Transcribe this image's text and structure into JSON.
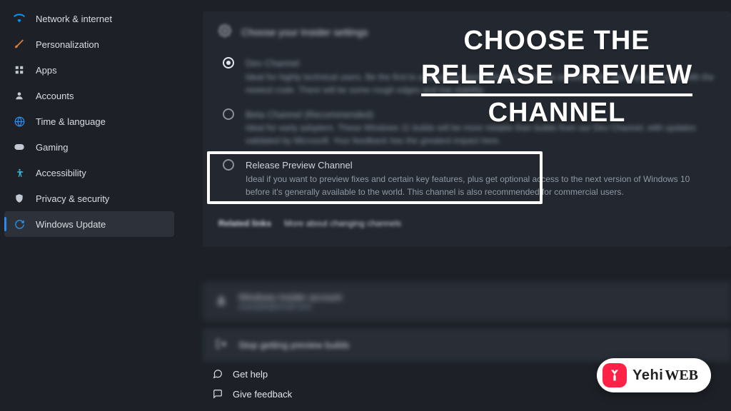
{
  "sidebar": {
    "items": [
      {
        "icon": "wifi-icon",
        "label": "Network & internet",
        "selected": false,
        "color": "#0099ff"
      },
      {
        "icon": "brush-icon",
        "label": "Personalization",
        "selected": false,
        "color": "#d67f3c"
      },
      {
        "icon": "grid-icon",
        "label": "Apps",
        "selected": false,
        "color": "#c1c8d1"
      },
      {
        "icon": "user-icon",
        "label": "Accounts",
        "selected": false,
        "color": "#c1c8d1"
      },
      {
        "icon": "globe-icon",
        "label": "Time & language",
        "selected": false,
        "color": "#2d8fe6"
      },
      {
        "icon": "gamepad-icon",
        "label": "Gaming",
        "selected": false,
        "color": "#c1c8d1"
      },
      {
        "icon": "access-icon",
        "label": "Accessibility",
        "selected": false,
        "color": "#44b5d6"
      },
      {
        "icon": "shield-icon",
        "label": "Privacy & security",
        "selected": false,
        "color": "#c1c8d1"
      },
      {
        "icon": "update-icon",
        "label": "Windows Update",
        "selected": true,
        "color": "#2d8fe6"
      }
    ]
  },
  "main": {
    "panel_title": "Choose your Insider settings",
    "options": [
      {
        "id": "dev",
        "title": "Dev Channel",
        "desc": "Ideal for highly technical users. Be the first to access the latest Windows 11 builds earliest in the development cycle with the newest code. There will be some rough edges and low stability.",
        "selected": true,
        "blurred": true
      },
      {
        "id": "beta",
        "title": "Beta Channel (Recommended)",
        "desc": "Ideal for early adopters. These Windows 11 builds will be more reliable than builds from our Dev Channel, with updates validated by Microsoft. Your feedback has the greatest impact here.",
        "selected": false,
        "blurred": true
      },
      {
        "id": "release",
        "title": "Release Preview Channel",
        "desc": "Ideal if you want to preview fixes and certain key features, plus get optional access to the next version of Windows 10 before it's generally available to the world. This channel is also recommended for commercial users.",
        "selected": false,
        "blurred": false
      }
    ],
    "related_label": "Related links",
    "related_link": "More about changing channels",
    "account_title": "Windows Insider account",
    "account_sub": "example@email.com",
    "stop_title": "Stop getting preview builds"
  },
  "footer": {
    "help": "Get help",
    "feedback": "Give feedback"
  },
  "overlay": {
    "line1": "CHOOSE THE",
    "line2": "RELEASE PREVIEW",
    "line3": "CHANNEL"
  },
  "logo": {
    "mark": "Y",
    "brand1": "Yehi",
    "brand2": "WEB"
  }
}
